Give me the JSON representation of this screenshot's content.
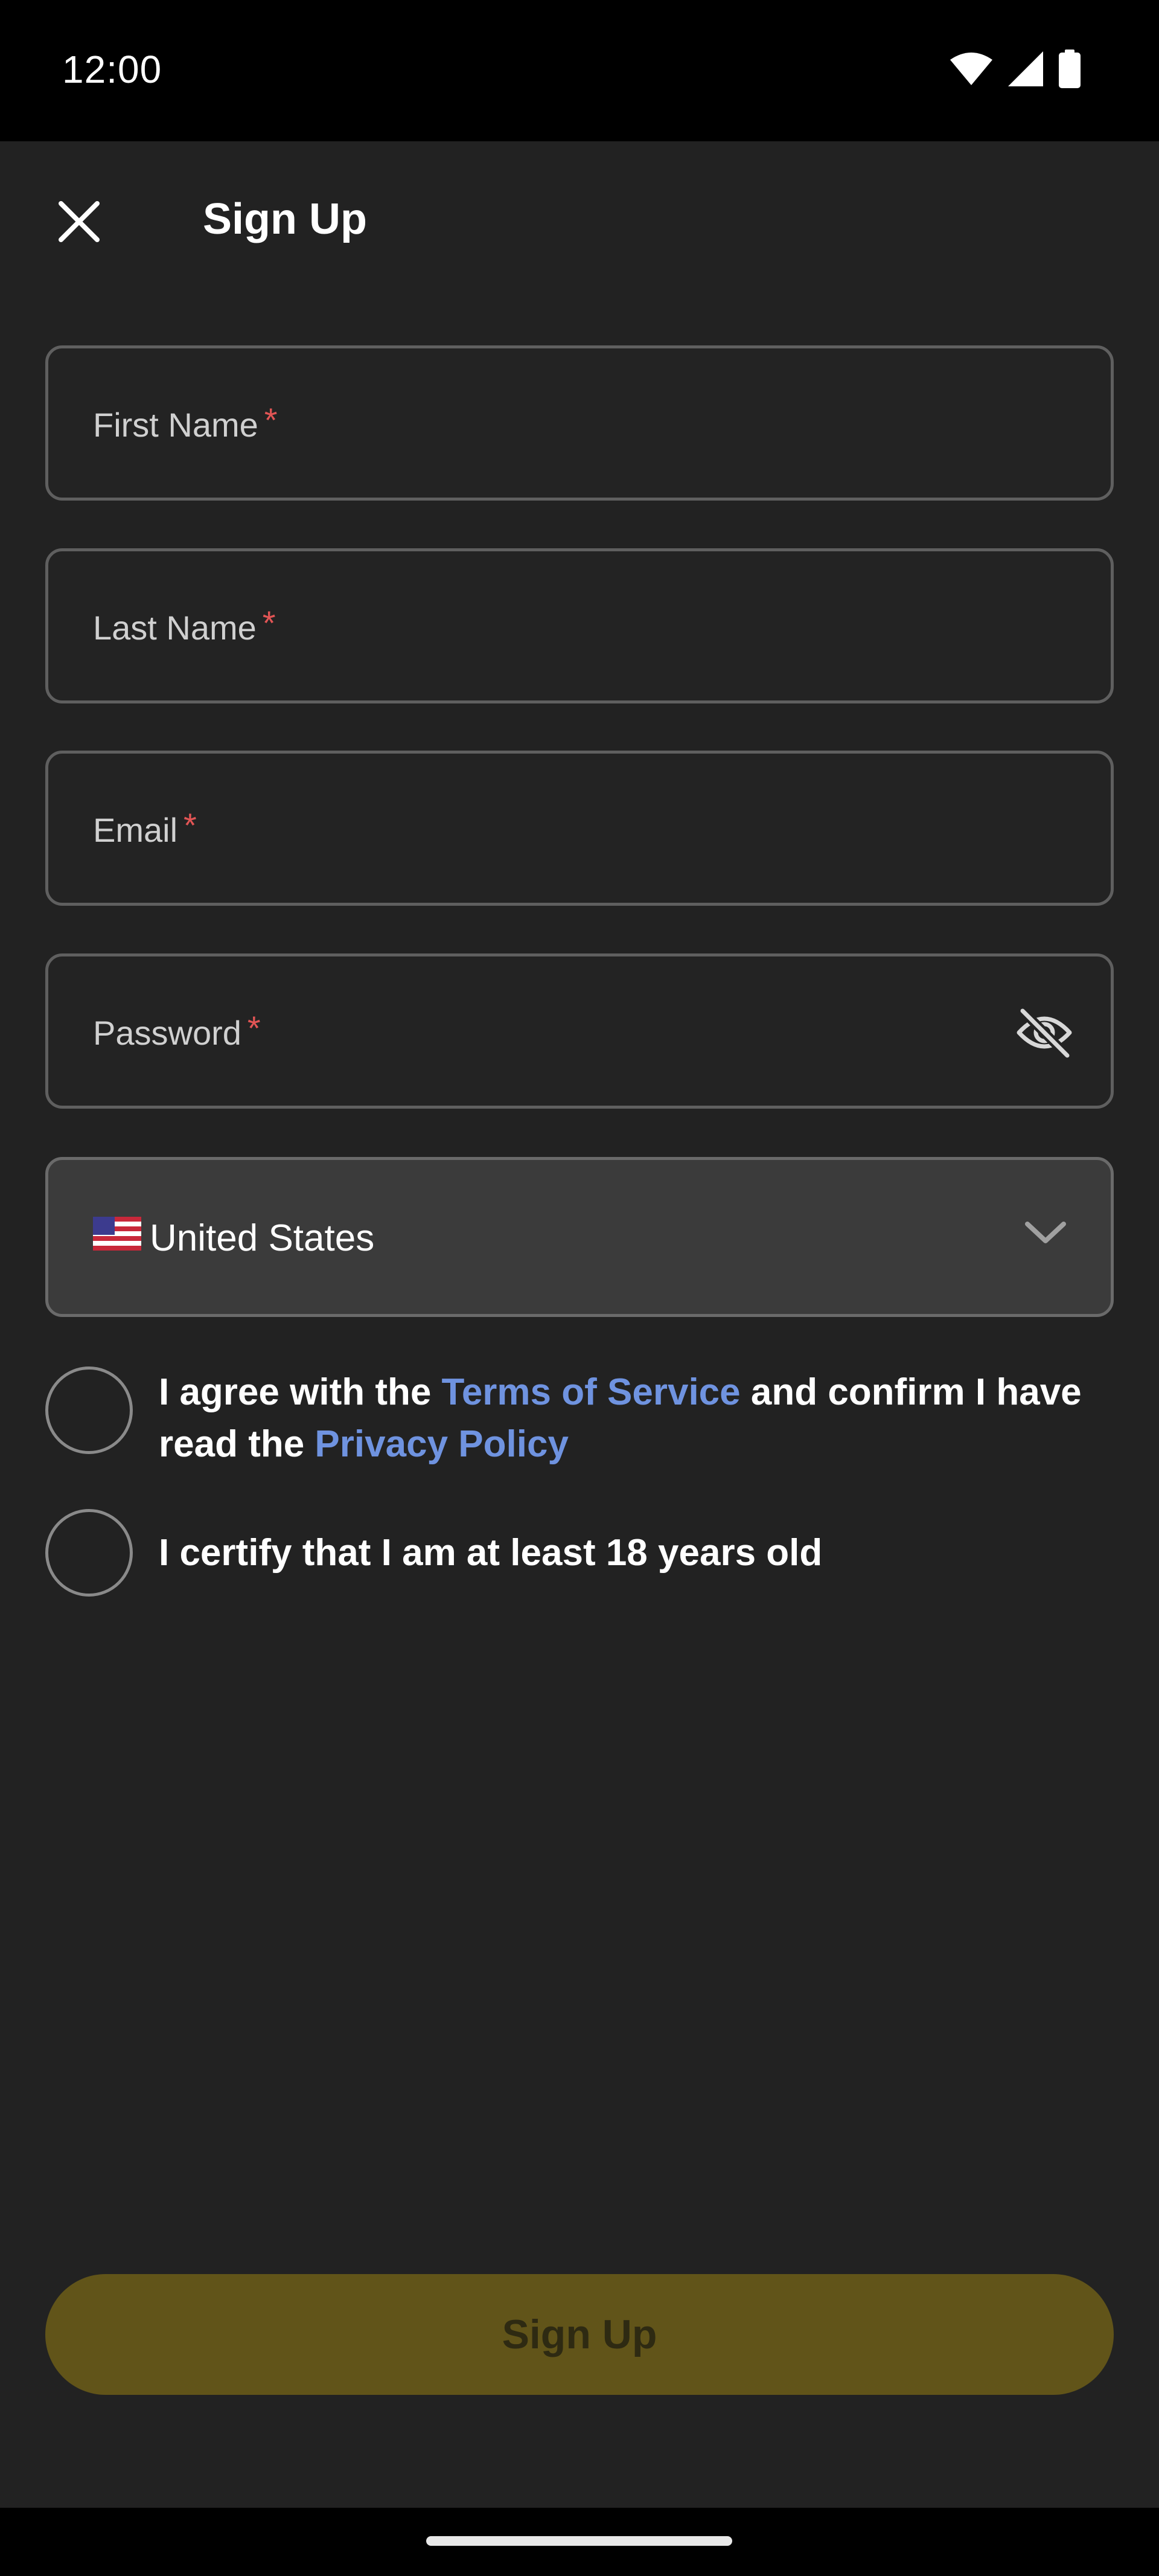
{
  "status_bar": {
    "time": "12:00",
    "icons": [
      "wifi-icon",
      "cellular-signal-icon",
      "battery-icon"
    ]
  },
  "header": {
    "close_icon": "close-icon",
    "title": "Sign Up"
  },
  "form": {
    "required_marker": "*",
    "first_name": {
      "label": "First Name",
      "value": ""
    },
    "last_name": {
      "label": "Last Name",
      "value": ""
    },
    "email": {
      "label": "Email",
      "value": ""
    },
    "password": {
      "label": "Password",
      "value": "",
      "toggle_icon": "eye-off-icon"
    },
    "country": {
      "flag": "us-flag-icon",
      "value": "United States",
      "icon": "chevron-down-icon"
    }
  },
  "agreements": {
    "terms": {
      "text_before": "I agree with the ",
      "terms_link": "Terms of Service",
      "text_middle": " and confirm I have read the ",
      "privacy_link": "Privacy Policy",
      "checked": false
    },
    "age": {
      "text": "I certify that I am at least 18 years old",
      "checked": false
    }
  },
  "actions": {
    "submit_label": "Sign Up",
    "disabled": true
  },
  "colors": {
    "background": "#222222",
    "link": "#6f93e0",
    "required": "#e25555",
    "button_disabled": "#615419"
  }
}
